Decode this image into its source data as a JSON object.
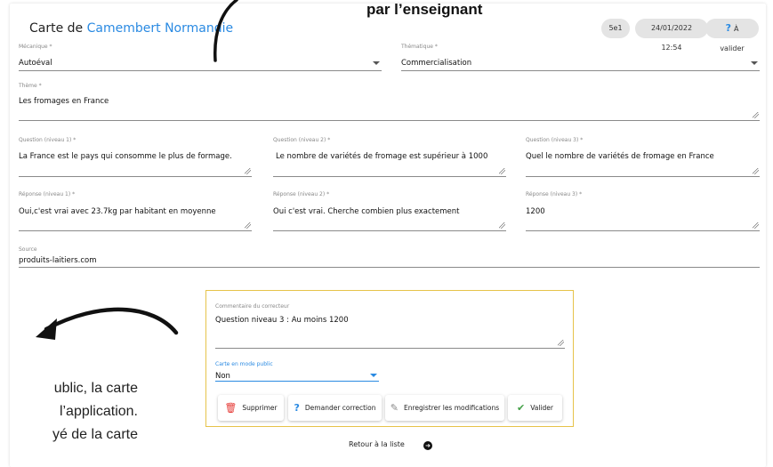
{
  "overlay_title": "par l’enseignant",
  "header": {
    "title_prefix": "Carte de",
    "deck_name": "Camembert Normandie",
    "class_badge": "5e1",
    "date_badge": "24/01/2022 12:54",
    "status_badge": "À valider"
  },
  "fields": {
    "mecanique": {
      "label": "Mécanique *",
      "value": "Autoéval"
    },
    "thematique": {
      "label": "Thématique *",
      "value": "Commercialisation"
    },
    "theme": {
      "label": "Thème *",
      "value": "Les fromages en France"
    },
    "q1": {
      "label": "Question (niveau 1) *",
      "value": "La France est le pays qui consomme le plus de formage."
    },
    "q2": {
      "label": "Question (niveau 2) *",
      "value": "Le nombre de variétés de fromage est supérieur à 1000"
    },
    "q3": {
      "label": "Question (niveau 3) *",
      "value": "Quel le nombre de variétés de fromage en France"
    },
    "r1": {
      "label": "Réponse (niveau 1) *",
      "value": "Oui,c'est vrai avec 23.7kg par habitant en moyenne"
    },
    "r2": {
      "label": "Réponse (niveau 2) *",
      "value": "Oui c'est vrai. Cherche combien plus exactement"
    },
    "r3": {
      "label": "Réponse (niveau 3) *",
      "value": "1200"
    },
    "source": {
      "label": "Source",
      "value": "produits-laitiers.com"
    }
  },
  "corrector": {
    "comment_label": "Commentaire du correcteur",
    "comment_value": "Question niveau 3 : Au moins 1200",
    "public_label": "Carte en mode public",
    "public_value": "Non",
    "buttons": {
      "delete": "Supprimer",
      "request": "Demander correction",
      "save": "Enregistrer les modifications",
      "validate": "Valider"
    }
  },
  "footer": {
    "back": "Retour à la liste"
  },
  "side_text": [
    "ublic, la carte",
    "l’application.",
    "yé de la carte"
  ],
  "colors": {
    "accent": "#2a8ae2",
    "danger": "#e53935",
    "success": "#43a047",
    "corrector_border": "#e6c34a"
  }
}
